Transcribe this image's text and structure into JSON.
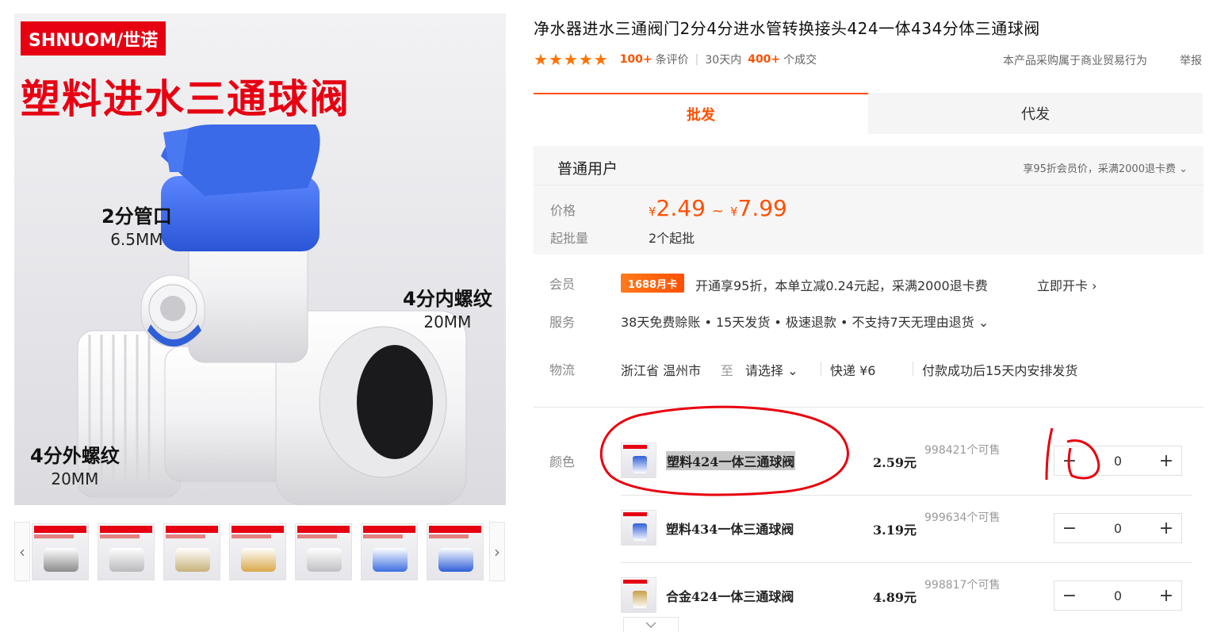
{
  "gallery": {
    "main": {
      "brand": "SHNUOM/世诺",
      "headline": "塑料进水三通球阀",
      "callouts": [
        {
          "title": "2分管口",
          "size": "6.5MM"
        },
        {
          "title": "4分内螺纹",
          "size": "20MM"
        },
        {
          "title": "4分外螺纹",
          "size": "20MM"
        }
      ]
    },
    "prev_arrow": "‹",
    "next_arrow": "›",
    "thumbnails": [
      {
        "part_color": "#8c8c8c"
      },
      {
        "part_color": "#b9b9bd"
      },
      {
        "part_color": "#c8b27a"
      },
      {
        "part_color": "#d9a84a"
      },
      {
        "part_color": "#c0c0c4"
      },
      {
        "part_color": "#3d6fe0"
      },
      {
        "part_color": "#2f5fd8"
      }
    ]
  },
  "product": {
    "title": "净水器进水三通阀门2分4分进水管转换接头424一体434分体三通球阀",
    "stars": 5,
    "review_count": "100+",
    "review_label": "条评价",
    "period": "30天内",
    "deal_count": "400+",
    "deal_label": "个成交",
    "trade_note": "本产品采购属于商业贸易行为",
    "report": "举报"
  },
  "tabs": [
    {
      "label": "批发",
      "active": true
    },
    {
      "label": "代发",
      "active": false
    }
  ],
  "member": {
    "type": "普通用户",
    "hint": "享95折会员价，采满2000退卡费 ⌄",
    "price_label": "价格",
    "currency": "¥",
    "price_min": "2.49",
    "tilde": "~",
    "price_max": "7.99",
    "moq_label": "起批量",
    "moq": "2个起批"
  },
  "services": {
    "member_label": "会员",
    "card_badge": "1688月卡",
    "card_text": "开通享95折，本单立减0.24元起，采满2000退卡费",
    "card_open": "立即开卡 ›",
    "service_label": "服务",
    "service_text": "38天免费赊账 • 15天发货 • 极速退款 • 不支持7天无理由退货 ⌄",
    "logistics_label": "物流",
    "origin": "浙江省 温州市",
    "to": "至",
    "dest": "请选择 ⌄",
    "express": "快递 ¥6",
    "delivery": "付款成功后15天内安排发货"
  },
  "skus_label": "颜色",
  "skus": [
    {
      "name": "塑料424一体三通球阀",
      "price": "2.59元",
      "stock": "998421个可售",
      "qty": "0",
      "thumb_color": "#2f5fd8"
    },
    {
      "name": "塑料434一体三通球阀",
      "price": "3.19元",
      "stock": "999634个可售",
      "qty": "0",
      "thumb_color": "#2f5fd8"
    },
    {
      "name": "合金424一体三通球阀",
      "price": "4.89元",
      "stock": "998817个可售",
      "qty": "0",
      "thumb_color": "#c8a048"
    }
  ],
  "stepper_minus": "−",
  "stepper_plus": "+",
  "expand_icon": "chevron-down-icon",
  "colors": {
    "accent": "#ff5000",
    "brand_red": "#e60012",
    "annotation": "#e8000d"
  }
}
